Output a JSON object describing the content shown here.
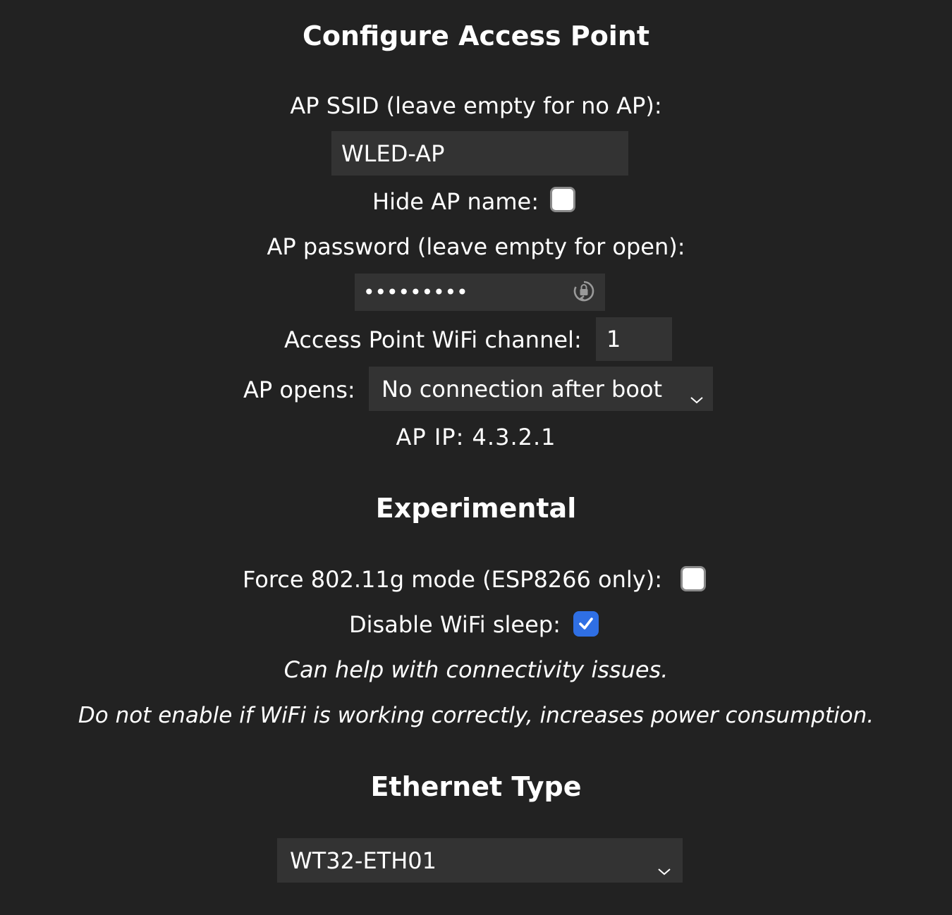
{
  "ap_section": {
    "heading": "Configure Access Point",
    "ssid_label": "AP SSID (leave empty for no AP):",
    "ssid_value": "WLED-AP",
    "hide_label": "Hide AP name:",
    "hide_checked": false,
    "password_label": "AP password (leave empty for open):",
    "password_mask": "•••••••••",
    "channel_label": "Access Point WiFi channel:",
    "channel_value": "1",
    "opens_label": "AP opens:",
    "opens_selected": "No connection after boot",
    "ip_text": "AP IP: 4.3.2.1"
  },
  "experimental": {
    "heading": "Experimental",
    "force_label": "Force 802.11g mode (ESP8266 only):",
    "force_checked": false,
    "sleep_label": "Disable WiFi sleep:",
    "sleep_checked": true,
    "note1": "Can help with connectivity issues.",
    "note2": "Do not enable if WiFi is working correctly, increases power consumption."
  },
  "ethernet": {
    "heading": "Ethernet Type",
    "selected": "WT32-ETH01"
  },
  "colors": {
    "background": "#222222",
    "field": "#333333",
    "accent": "#2f6fe4"
  },
  "icons": {
    "password_reveal": "lock-reload-icon",
    "dropdown": "chevron-down-icon",
    "check": "checkmark-icon"
  }
}
